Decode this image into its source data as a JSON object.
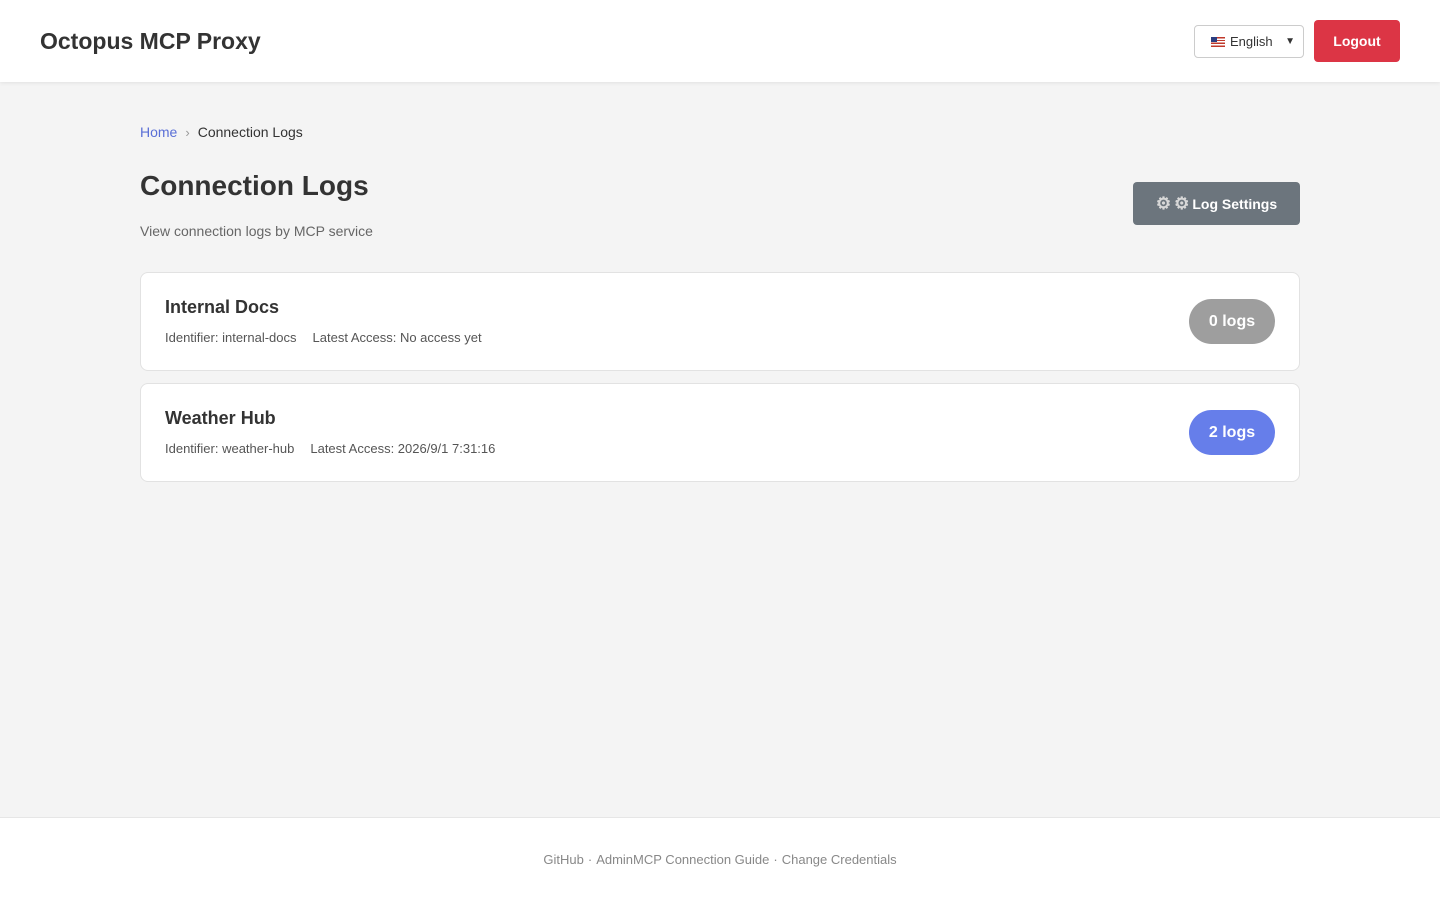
{
  "header": {
    "title": "Octopus MCP Proxy",
    "language": "English",
    "logout_label": "Logout"
  },
  "breadcrumb": {
    "home": "Home",
    "separator": "›",
    "current": "Connection Logs"
  },
  "page": {
    "title": "Connection Logs",
    "subtitle": "View connection logs by MCP service",
    "settings_label": "Log Settings"
  },
  "services": [
    {
      "name": "Internal Docs",
      "identifier": "Identifier: internal-docs",
      "latest_access": "Latest Access: No access yet",
      "log_count": "0 logs",
      "badge_color": "#9e9e9e"
    },
    {
      "name": "Weather Hub",
      "identifier": "Identifier: weather-hub",
      "latest_access": "Latest Access: 2026/9/1 7:31:16",
      "log_count": "2 logs",
      "badge_color": "#667eea"
    }
  ],
  "footer": {
    "github": "GitHub",
    "admin_guide": "AdminMCP Connection Guide",
    "change_credentials": "Change Credentials",
    "separator": "·"
  },
  "colors": {
    "accent": "#667eea",
    "danger": "#dc3545",
    "secondary": "#6c757d",
    "link": "#5a6fd6"
  }
}
